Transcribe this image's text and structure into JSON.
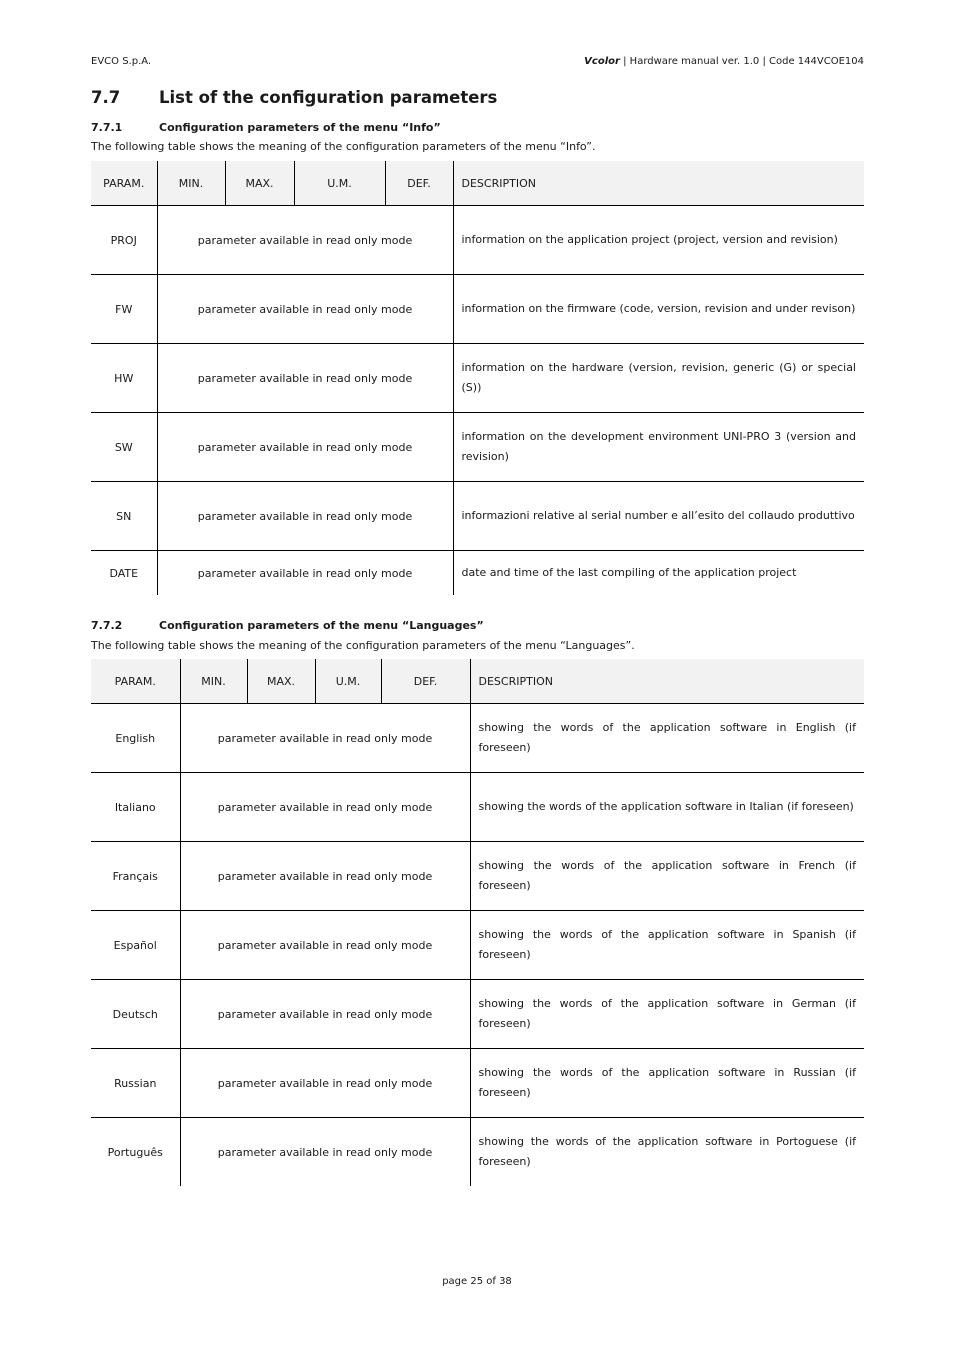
{
  "header": {
    "company": "EVCO S.p.A.",
    "product": "Vcolor",
    "manual": " | Hardware manual ver. 1.0 | Code 144VCOE104"
  },
  "section": {
    "number": "7.7",
    "title": "List of the configuration parameters"
  },
  "subsections": [
    {
      "number": "7.7.1",
      "title": "Configuration parameters of the menu “Info”",
      "intro": "The following table shows the meaning of the configuration parameters of the menu “Info”.",
      "columns": [
        "PARAM.",
        "MIN.",
        "MAX.",
        "U.M.",
        "DEF.",
        "DESCRIPTION"
      ],
      "rows": [
        {
          "param": "PROJ",
          "value": "parameter available in read only mode",
          "description": "information on the application project (project, version and revision)"
        },
        {
          "param": "FW",
          "value": "parameter available in read only mode",
          "description": "information on the firmware (code, version, revision and under revison)"
        },
        {
          "param": "HW",
          "value": "parameter available in read only mode",
          "description": "information on the hardware (version, revision, generic (G) or special (S))"
        },
        {
          "param": "SW",
          "value": "parameter available in read only mode",
          "description": "information on the development environment UNI-PRO 3 (version and revision)"
        },
        {
          "param": "SN",
          "value": "parameter available in read only mode",
          "description": "informazioni relative al serial number e all’esito del collaudo produttivo"
        },
        {
          "param": "DATE",
          "value": "parameter available in read only mode",
          "description": "date and time of the last compiling of the application project"
        }
      ]
    },
    {
      "number": "7.7.2",
      "title": "Configuration parameters of the menu “Languages”",
      "intro": "The following table shows the meaning of the configuration parameters of the menu “Languages”.",
      "columns": [
        "PARAM.",
        "MIN.",
        "MAX.",
        "U.M.",
        "DEF.",
        "DESCRIPTION"
      ],
      "rows": [
        {
          "param": "English",
          "value": "parameter available in read only mode",
          "description": "showing the words of the application software in English (if foreseen)"
        },
        {
          "param": "Italiano",
          "value": "parameter available in read only mode",
          "description": "showing the words of the application software in Italian (if foreseen)"
        },
        {
          "param": "Français",
          "value": "parameter available in read only mode",
          "description": "showing the words of the application software in French (if foreseen)"
        },
        {
          "param": "Español",
          "value": "parameter available in read only mode",
          "description": "showing the words of the application software in Spanish (if foreseen)"
        },
        {
          "param": "Deutsch",
          "value": "parameter available in read only mode",
          "description": "showing the words of the application software in German (if foreseen)"
        },
        {
          "param": "Russian",
          "value": "parameter available in read only mode",
          "description": "showing the words of the application software in Russian (if foreseen)"
        },
        {
          "param": "Português",
          "value": "parameter available in read only mode",
          "description": "showing the words of the application software in Portoguese (if foreseen)"
        }
      ]
    }
  ],
  "footer": {
    "page": "page 25 of 38"
  }
}
